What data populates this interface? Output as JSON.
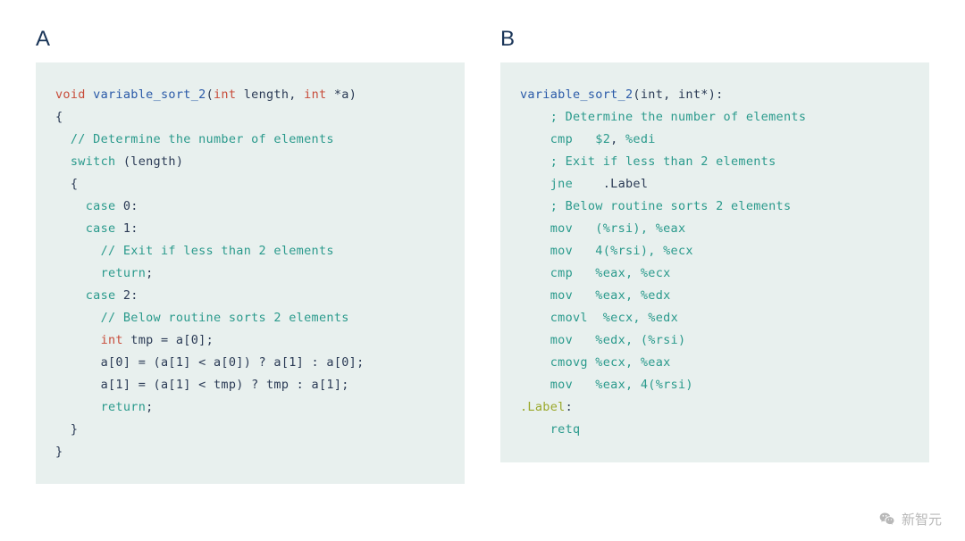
{
  "panels": {
    "a": {
      "label": "A"
    },
    "b": {
      "label": "B"
    }
  },
  "code_a": {
    "l1_void": "void",
    "l1_fn": " variable_sort_2",
    "l1_paren_open": "(",
    "l1_int1": "int",
    "l1_length": " length, ",
    "l1_int2": "int",
    "l1_ptr_a": " *a)",
    "l2": "{",
    "l3_comment": "  // Determine the number of elements",
    "l4_switch": "  switch",
    "l4_rest": " (length)",
    "l5": "  {",
    "l6_case": "    case",
    "l6_rest": " 0:",
    "l7_case": "    case",
    "l7_rest": " 1:",
    "l8_comment": "      // Exit if less than 2 elements",
    "l9_return": "      return",
    "l9_semi": ";",
    "l10_case": "    case",
    "l10_rest": " 2:",
    "l11_comment": "      // Below routine sorts 2 elements",
    "l12_int": "      int",
    "l12_rest": " tmp = a[0];",
    "l13": "      a[0] = (a[1] < a[0]) ? a[1] : a[0];",
    "l14": "      a[1] = (a[1] < tmp) ? tmp : a[1];",
    "l15_return": "      return",
    "l15_semi": ";",
    "l16": "  }",
    "l17": "}"
  },
  "code_b": {
    "l1_fn": "variable_sort_2",
    "l1_args": "(int, int*):",
    "l2_comment": "    ; Determine the number of elements",
    "l3_op": "    cmp",
    "l3_arg1": "   $2",
    "l3_comma": ", ",
    "l3_arg2": "%edi",
    "l4_comment": "    ; Exit if less than 2 elements",
    "l5_op": "    jne",
    "l5_sp": "    ",
    "l5_label": ".Label",
    "l6_comment": "    ; Below routine sorts 2 elements",
    "l7_op": "    mov",
    "l7_args": "   (%rsi), %eax",
    "l8_op": "    mov",
    "l8_args": "   4(%rsi), %ecx",
    "l9_op": "    cmp",
    "l9_args": "   %eax, %ecx",
    "l10_op": "    mov",
    "l10_args": "   %eax, %edx",
    "l11_op": "    cmovl",
    "l11_args": "  %ecx, %edx",
    "l12_op": "    mov",
    "l12_args": "   %edx, (%rsi)",
    "l13_op": "    cmovg",
    "l13_args": " %ecx, %eax",
    "l14_op": "    mov",
    "l14_args": "   %eax, 4(%rsi)",
    "l15_label": ".Label",
    "l15_colon": ":",
    "l16_op": "    retq"
  },
  "attribution": "新智元"
}
